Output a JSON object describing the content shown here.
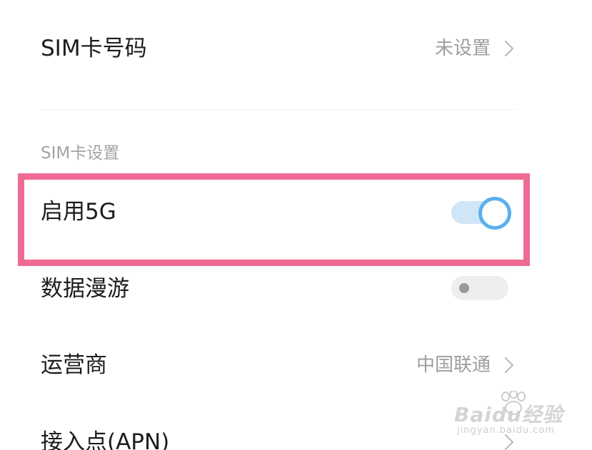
{
  "rows": {
    "sim_number": {
      "label": "SIM卡号码",
      "value": "未设置"
    },
    "enable_5g": {
      "label": "启用5G",
      "enabled": true
    },
    "data_roaming": {
      "label": "数据漫游",
      "enabled": false
    },
    "carrier": {
      "label": "运营商",
      "value": "中国联通"
    },
    "apn": {
      "label": "接入点(APN)"
    }
  },
  "section": {
    "sim_settings_header": "SIM卡设置"
  },
  "watermark": {
    "text": "Baidu经验",
    "url_text": "jingyan.baidu.com"
  },
  "colors": {
    "highlight": "#ef6b93",
    "toggle_on_accent": "#5bb0ee",
    "toggle_on_track": "#cfe6f8",
    "toggle_off_track": "#eeeeee"
  }
}
